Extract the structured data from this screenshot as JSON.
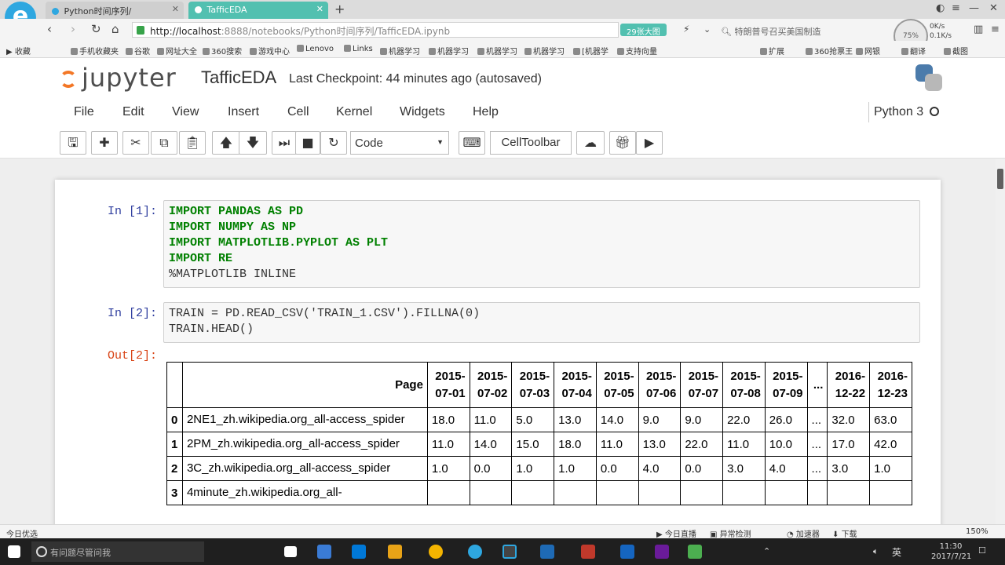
{
  "browser": {
    "tabs": [
      {
        "label": "Python时间序列/",
        "active": false
      },
      {
        "label": "TafficEDA",
        "active": true
      }
    ],
    "new_tab": "+",
    "url_host": "http://localhost",
    "url_rest": ":8888/notebooks/Python时间序列/TafficEDA.ipynb",
    "pill": "29张大图",
    "search": "特朗普号召买美国制造",
    "speed_up": "0K/s",
    "speed_down": "0.1K/s",
    "speed_badge": "75%",
    "bookmarks": [
      "收藏",
      "手机收藏夹",
      "谷歌",
      "网址大全",
      "360搜索",
      "游戏中心",
      "Lenovo",
      "Links",
      "机器学习",
      "机器学习",
      "机器学习",
      "机器学习",
      "[机器学",
      "支持向量"
    ],
    "bookmarks_right": [
      "扩展",
      "360抢票王",
      "网银",
      "翻译",
      "截图"
    ]
  },
  "jupyter": {
    "logo": "jupyter",
    "notebook_name": "TafficEDA",
    "checkpoint": "Last Checkpoint: 44 minutes ago (autosaved)",
    "menus": [
      "File",
      "Edit",
      "View",
      "Insert",
      "Cell",
      "Kernel",
      "Widgets",
      "Help"
    ],
    "kernel": "Python 3",
    "cell_type": "Code",
    "cell_toolbar": "CellToolbar"
  },
  "cells": [
    {
      "prompt": "In [1]:",
      "lines": [
        "IMPORT PANDAS AS PD",
        "IMPORT NUMPY AS NP",
        "IMPORT MATPLOTLIB.PYPLOT AS PLT",
        "IMPORT RE",
        "%MATPLOTLIB INLINE"
      ]
    },
    {
      "prompt": "In [2]:",
      "lines": [
        "TRAIN = PD.READ_CSV('TRAIN_1.CSV').FILLNA(0)",
        "TRAIN.HEAD()"
      ]
    }
  ],
  "output": {
    "prompt": "Out[2]:",
    "columns": [
      "Page",
      "2015-07-01",
      "2015-07-02",
      "2015-07-03",
      "2015-07-04",
      "2015-07-05",
      "2015-07-06",
      "2015-07-07",
      "2015-07-08",
      "2015-07-09",
      "...",
      "2016-12-22",
      "2016-12-23"
    ],
    "rows": [
      {
        "index": "0",
        "page": "2NE1_zh.wikipedia.org_all-access_spider",
        "values": [
          "18.0",
          "11.0",
          "5.0",
          "13.0",
          "14.0",
          "9.0",
          "9.0",
          "22.0",
          "26.0",
          "...",
          "32.0",
          "63.0"
        ]
      },
      {
        "index": "1",
        "page": "2PM_zh.wikipedia.org_all-access_spider",
        "values": [
          "11.0",
          "14.0",
          "15.0",
          "18.0",
          "11.0",
          "13.0",
          "22.0",
          "11.0",
          "10.0",
          "...",
          "17.0",
          "42.0"
        ]
      },
      {
        "index": "2",
        "page": "3C_zh.wikipedia.org_all-access_spider",
        "values": [
          "1.0",
          "0.0",
          "1.0",
          "1.0",
          "0.0",
          "4.0",
          "0.0",
          "3.0",
          "4.0",
          "...",
          "3.0",
          "1.0"
        ]
      },
      {
        "index": "3",
        "page": "4minute_zh.wikipedia.org_all-",
        "values": [
          "",
          "",
          "",
          "",
          "",
          "",
          "",
          "",
          "",
          "",
          "",
          ""
        ]
      }
    ]
  },
  "statusbar": {
    "left": "今日优选",
    "items": [
      "今日直播",
      "异常检测",
      "加速器",
      "下载"
    ],
    "zoom": "150%"
  },
  "taskbar": {
    "search": "有问题尽管问我",
    "ime": "英",
    "time": "11:30",
    "date": "2017/7/21"
  }
}
